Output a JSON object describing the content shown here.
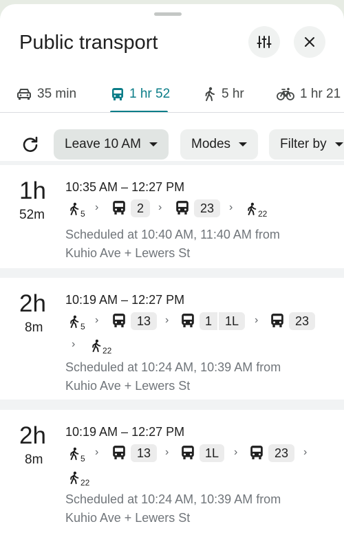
{
  "header": {
    "title": "Public transport"
  },
  "tabs": [
    {
      "label": "35 min",
      "icon": "car-icon"
    },
    {
      "label": "1 hr 52",
      "icon": "bus-icon",
      "active": true
    },
    {
      "label": "5 hr",
      "icon": "walk-icon"
    },
    {
      "label": "1 hr 21",
      "icon": "bike-icon"
    }
  ],
  "controls": {
    "leave_label": "Leave 10 AM",
    "modes_label": "Modes",
    "filter_label": "Filter by"
  },
  "routes": [
    {
      "hours": "1h",
      "minutes": "52m",
      "time_range": "10:35 AM – 12:27 PM",
      "walk_start": "5",
      "walk_end": "22",
      "buses": [
        "2",
        "23"
      ],
      "schedule_line1": "Scheduled at 10:40 AM, 11:40 AM from",
      "schedule_line2": "Kuhio Ave + Lewers St"
    },
    {
      "hours": "2h",
      "minutes": "8m",
      "time_range": "10:19 AM – 12:27 PM",
      "walk_start": "5",
      "walk_end": "22",
      "buses": [
        "13",
        "1",
        "1L",
        "23"
      ],
      "schedule_line1": "Scheduled at 10:24 AM, 10:39 AM from",
      "schedule_line2": "Kuhio Ave + Lewers St"
    },
    {
      "hours": "2h",
      "minutes": "8m",
      "time_range": "10:19 AM – 12:27 PM",
      "walk_start": "5",
      "walk_end": "22",
      "buses": [
        "13",
        "1L",
        "23"
      ],
      "schedule_line1": "Scheduled at 10:24 AM, 10:39 AM from",
      "schedule_line2": "Kuhio Ave + Lewers St"
    }
  ],
  "colors": {
    "accent": "#0b7d88",
    "secondary_text": "#70757a"
  }
}
